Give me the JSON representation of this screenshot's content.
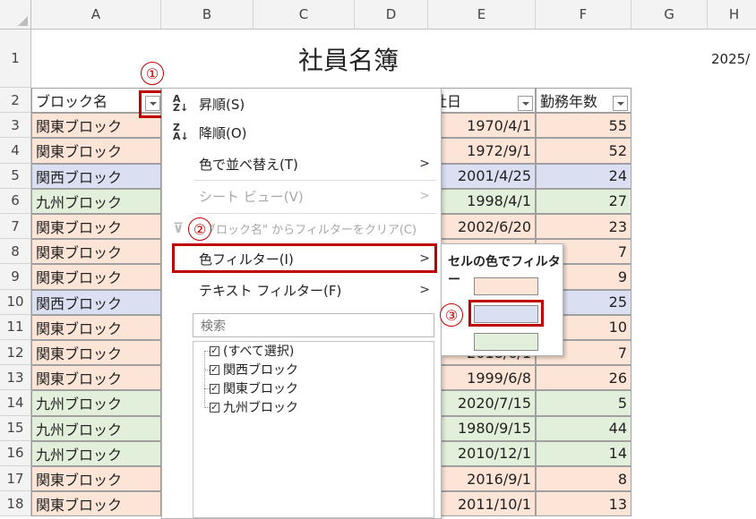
{
  "columns": [
    "A",
    "B",
    "C",
    "D",
    "E",
    "F",
    "G",
    "H"
  ],
  "rows": [
    "1",
    "2",
    "3",
    "4",
    "5",
    "6",
    "7",
    "8",
    "9",
    "10",
    "11",
    "12",
    "13",
    "14",
    "15",
    "16",
    "17",
    "18"
  ],
  "sheet_title": "社員名簿",
  "date_partial": "2025/",
  "headers": {
    "block": "ブロック名",
    "join": "社日",
    "years": "勤務年数"
  },
  "data_rows": [
    {
      "block": "関東ブロック",
      "date": "1970/4/1",
      "years": "55",
      "color": "#fce4d6"
    },
    {
      "block": "関東ブロック",
      "date": "1972/9/1",
      "years": "52",
      "color": "#fce4d6"
    },
    {
      "block": "関西ブロック",
      "date": "2001/4/25",
      "years": "24",
      "color": "#dae0f2"
    },
    {
      "block": "九州ブロック",
      "date": "1998/4/1",
      "years": "27",
      "color": "#e2efda"
    },
    {
      "block": "関東ブロック",
      "date": "2002/6/20",
      "years": "23",
      "color": "#fce4d6"
    },
    {
      "block": "関東ブロック",
      "date": "",
      "years": "7",
      "color": "#fce4d6"
    },
    {
      "block": "関東ブロック",
      "date": "",
      "years": "9",
      "color": "#fce4d6"
    },
    {
      "block": "関西ブロック",
      "date": "",
      "years": "25",
      "color": "#dae0f2"
    },
    {
      "block": "関東ブロック",
      "date": "",
      "years": "10",
      "color": "#fce4d6"
    },
    {
      "block": "関東ブロック",
      "date": "2018/6/1",
      "years": "7",
      "color": "#fce4d6"
    },
    {
      "block": "関東ブロック",
      "date": "1999/6/8",
      "years": "26",
      "color": "#fce4d6"
    },
    {
      "block": "九州ブロック",
      "date": "2020/7/15",
      "years": "5",
      "color": "#e2efda"
    },
    {
      "block": "九州ブロック",
      "date": "1980/9/15",
      "years": "44",
      "color": "#e2efda"
    },
    {
      "block": "九州ブロック",
      "date": "2010/12/1",
      "years": "14",
      "color": "#e2efda"
    },
    {
      "block": "関東ブロック",
      "date": "2016/9/1",
      "years": "8",
      "color": "#fce4d6"
    },
    {
      "block": "関東ブロック",
      "date": "2011/10/1",
      "years": "13",
      "color": "#fce4d6"
    }
  ],
  "menu": {
    "sort_asc": "昇順(S)",
    "sort_desc": "降順(O)",
    "sort_by_color": "色で並べ替え(T)",
    "sheet_view": "シート ビュー(V)",
    "clear_filter": "\"ブロック名\" からフィルターをクリア(C)",
    "color_filter": "色フィルター(I)",
    "text_filter": "テキスト フィルター(F)",
    "search_placeholder": "検索",
    "list": [
      "(すべて選択)",
      "関西ブロック",
      "関東ブロック",
      "九州ブロック"
    ],
    "az_icon": "sort-ascending-icon",
    "za_icon": "sort-descending-icon"
  },
  "submenu": {
    "title": "セルの色でフィルター",
    "swatches": [
      "#fce4d6",
      "#dae0f2",
      "#e2efda"
    ]
  },
  "callouts": [
    "①",
    "②",
    "③"
  ],
  "accent": "#c00000"
}
